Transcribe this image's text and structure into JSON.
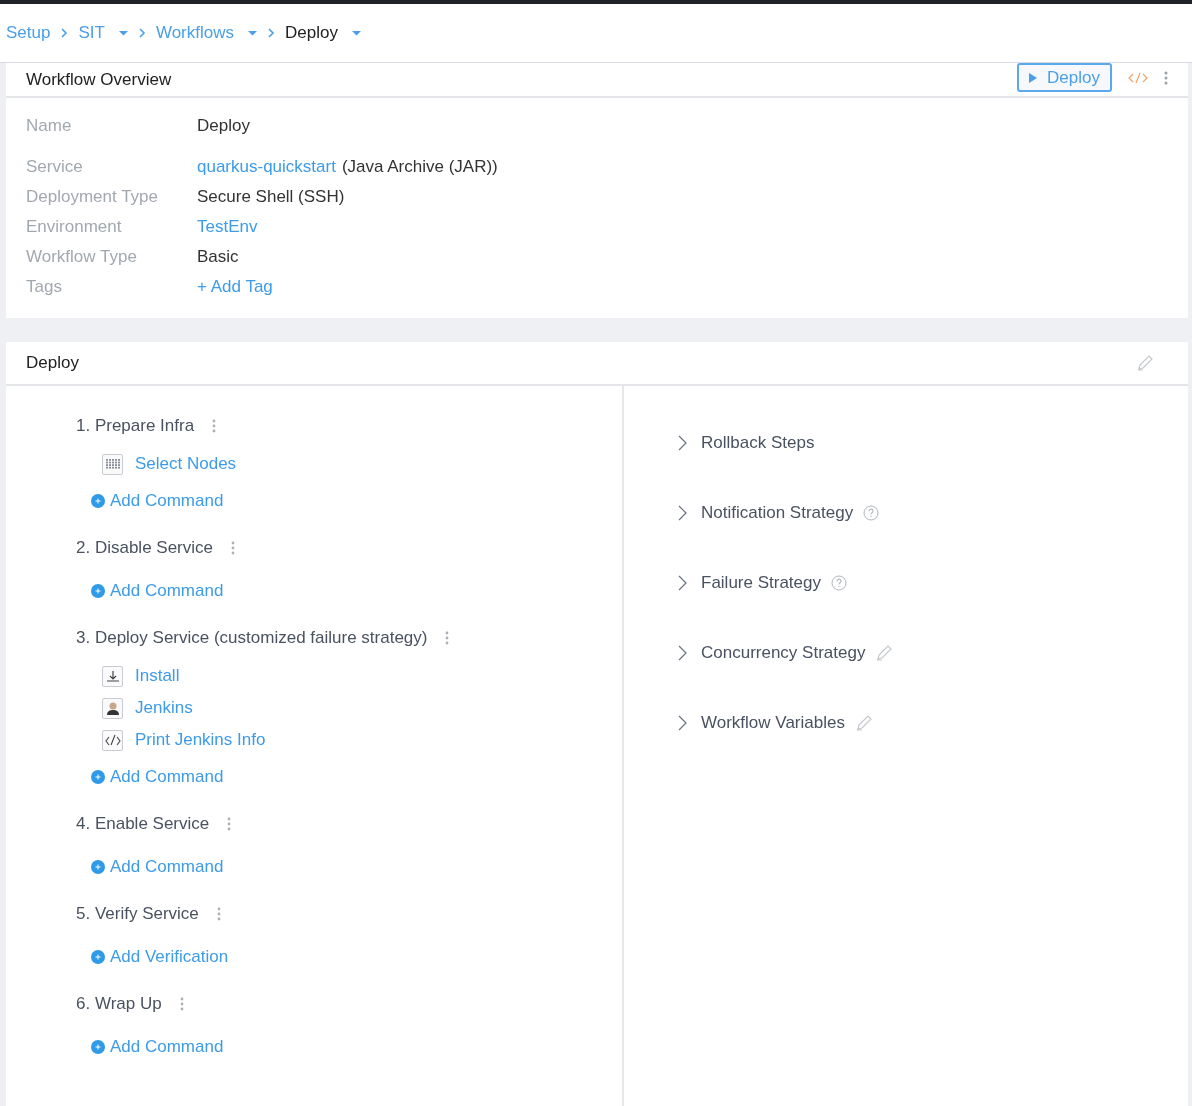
{
  "breadcrumbs": [
    {
      "label": "Setup",
      "dropdown": false,
      "current": false
    },
    {
      "label": "SIT",
      "dropdown": true,
      "current": false
    },
    {
      "label": "Workflows",
      "dropdown": true,
      "current": false
    },
    {
      "label": "Deploy",
      "dropdown": true,
      "current": true
    }
  ],
  "overview": {
    "title": "Workflow Overview",
    "deploy_button": "Deploy",
    "fields": [
      {
        "label": "Name",
        "value": "Deploy",
        "kind": "text"
      },
      {
        "label": "Service",
        "value": "quarkus-quickstart",
        "suffix": "(Java Archive (JAR))",
        "kind": "link"
      },
      {
        "label": "Deployment Type",
        "value": "Secure Shell (SSH)",
        "kind": "text"
      },
      {
        "label": "Environment",
        "value": "TestEnv",
        "kind": "link"
      },
      {
        "label": "Workflow Type",
        "value": "Basic",
        "kind": "text"
      },
      {
        "label": "Tags",
        "value": "+ Add Tag",
        "kind": "link"
      }
    ]
  },
  "deploy": {
    "title": "Deploy",
    "steps": [
      {
        "title": "1. Prepare Infra",
        "commands": [
          {
            "label": "Select Nodes",
            "kind": "nodes"
          }
        ],
        "add_label": "Add Command"
      },
      {
        "title": "2. Disable Service",
        "add_label": "Add Command"
      },
      {
        "title": "3. Deploy Service  (customized failure strategy)",
        "commands": [
          {
            "label": "Install",
            "kind": "install"
          },
          {
            "label": "Jenkins",
            "kind": "jenkins"
          },
          {
            "label": "Print Jenkins Info",
            "kind": "script"
          }
        ],
        "add_label": "Add Command"
      },
      {
        "title": "4. Enable Service",
        "add_label": "Add Command"
      },
      {
        "title": "5. Verify Service",
        "add_label": "Add Verification"
      },
      {
        "title": "6. Wrap Up",
        "add_label": "Add Command"
      }
    ],
    "sections": [
      {
        "label": "Rollback Steps",
        "kind": "plain"
      },
      {
        "label": "Notification Strategy",
        "kind": "help"
      },
      {
        "label": "Failure Strategy",
        "kind": "help"
      },
      {
        "label": "Concurrency Strategy",
        "kind": "edit"
      },
      {
        "label": "Workflow Variables",
        "kind": "edit"
      }
    ]
  }
}
